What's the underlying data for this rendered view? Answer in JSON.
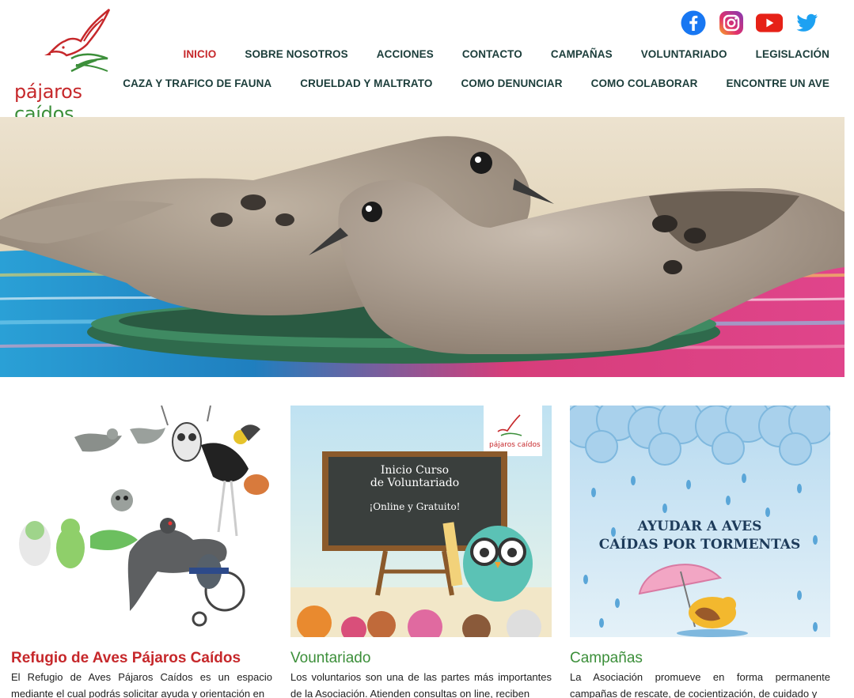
{
  "brand": {
    "name_part1": "pájaros",
    "name_part2": "caídos",
    "colors": {
      "red": "#c6282b",
      "green": "#3c8f3a",
      "nav": "#1b3d3a"
    }
  },
  "socials": [
    {
      "name": "facebook-icon",
      "color": "#1877f2"
    },
    {
      "name": "instagram-icon",
      "color": "#c13584"
    },
    {
      "name": "youtube-icon",
      "color": "#e62117"
    },
    {
      "name": "twitter-icon",
      "color": "#1da1f2"
    }
  ],
  "nav": {
    "row1": [
      "INICIO",
      "SOBRE NOSOTROS",
      "ACCIONES",
      "CONTACTO",
      "CAMPAÑAS",
      "VOLUNTARIADO",
      "LEGISLACIÓN"
    ],
    "row2": [
      "CAZA Y TRAFICO DE FAUNA",
      "CRUELDAD Y MALTRATO",
      "COMO DENUNCIAR",
      "COMO COLABORAR",
      "ENCONTRE UN AVE"
    ],
    "active": "INICIO"
  },
  "cards": [
    {
      "title": "Refugio de Aves Pájaros Caídos",
      "text": "El Refugio de Aves Pájaros Caídos es un espacio mediante el cual podrás solicitar ayuda y orientación en"
    },
    {
      "title": "Vountariado",
      "text": "Los voluntarios son una de las partes más importantes de la Asociación. Atienden consultas on line, reciben",
      "board_line1": "Inicio Curso",
      "board_line2": "de Voluntariado",
      "board_line3": "¡Online y Gratuito!",
      "badge_text": "pájaros caídos"
    },
    {
      "title": "Campañas",
      "text": "La Asociación promueve en forma permanente campañas de rescate, de cocientización, de cuidado y",
      "image_line1": "AYUDAR A AVES",
      "image_line2": "CAÍDAS POR TORMENTAS"
    }
  ]
}
